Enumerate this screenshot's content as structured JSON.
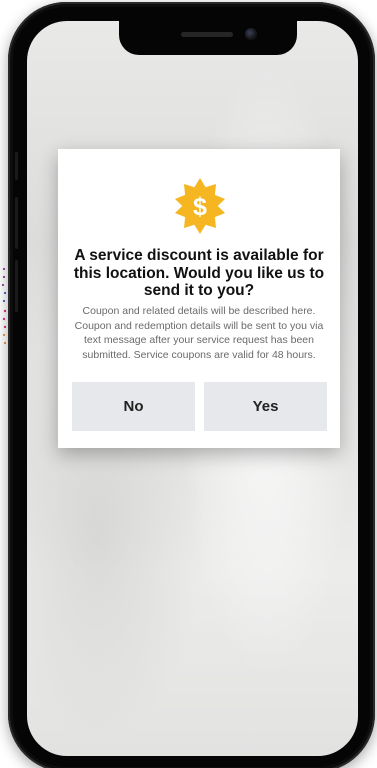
{
  "dialog": {
    "icon": "dollar-badge-icon",
    "title": "A service discount is available for this location. Would you like us to send it to you?",
    "description": "Coupon and related details will be described here. Coupon and redemption details will be sent to you via text message after your service request has been submitted. Service coupons are valid for 48 hours.",
    "no_label": "No",
    "yes_label": "Yes"
  },
  "colors": {
    "badge": "#f5b621",
    "badge_symbol": "#ffffff",
    "button_bg": "#e7e8eb",
    "title_text": "#111111",
    "description_text": "#6a6a6a"
  }
}
